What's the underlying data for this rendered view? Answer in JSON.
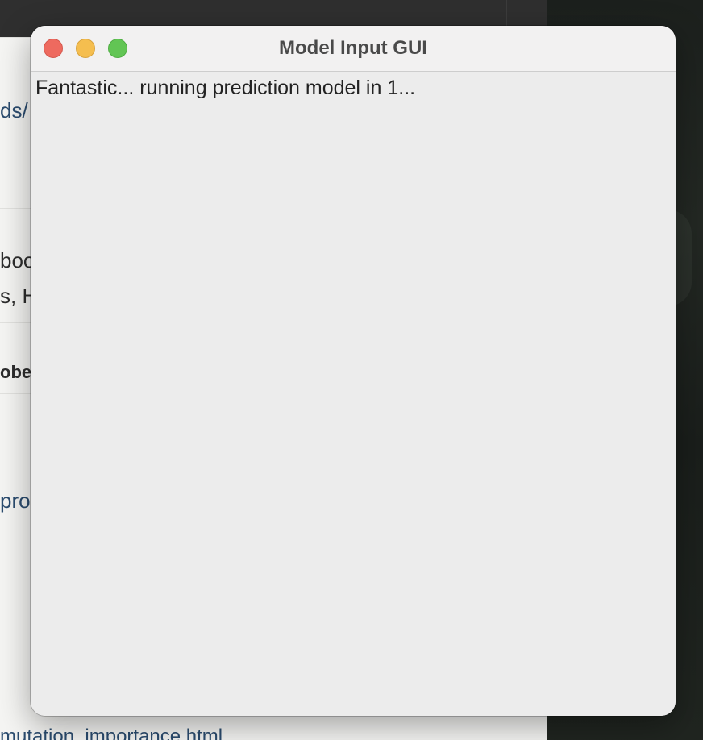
{
  "window": {
    "title": "Model Input GUI",
    "status_message": "Fantastic... running prediction model in 1..."
  },
  "background_page": {
    "fragments": [
      {
        "id": "frag-1",
        "text": "ds/",
        "style": "link"
      },
      {
        "id": "frag-2",
        "text": "boo",
        "style": "plain"
      },
      {
        "id": "frag-3",
        "text": "s, H",
        "style": "plain"
      },
      {
        "id": "frag-4",
        "text": "obe",
        "style": "bold"
      },
      {
        "id": "frag-5",
        "text": "proc",
        "style": "link"
      },
      {
        "id": "frag-6",
        "text": "mutation_importance.html",
        "style": "link"
      }
    ]
  },
  "colors": {
    "close": "#ee6a5f",
    "minimize": "#f5be4f",
    "zoom": "#62c554",
    "window_bg": "#ececec",
    "titlebar_bg": "#f2f1f1"
  },
  "icons": {
    "close": "close-traffic-light-icon",
    "minimize": "minimize-traffic-light-icon",
    "zoom": "zoom-traffic-light-icon"
  }
}
